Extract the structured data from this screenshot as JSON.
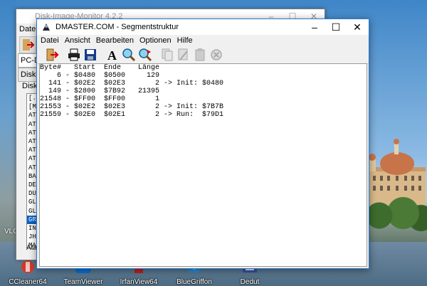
{
  "back_window": {
    "title": "Disk-Image-Monitor 4.2.2",
    "menu": [
      "Datei"
    ],
    "tab_pcdir": "PC-Dir",
    "tab_diskim": "Disk-Im",
    "disk_label": "Disk",
    "files": [
      "[..",
      "[MA",
      "ATM",
      "ATM",
      "ATM",
      "ATM",
      "ATM",
      "ATM",
      "ATM",
      "BAS",
      "DEM",
      "DUM",
      "GLU",
      "GLU",
      "GRA",
      "INS",
      "JHV",
      "MAS",
      "POK"
    ],
    "selected_index": 14,
    "status_label": "Atari"
  },
  "window": {
    "title": "DMASTER.COM - Segmentstruktur",
    "controls": {
      "minimize": "–",
      "maximize": "☐",
      "close": "✕"
    },
    "menu": [
      "Datei",
      "Ansicht",
      "Bearbeiten",
      "Optionen",
      "Hilfe"
    ],
    "toolbar_icons": [
      "exit-icon",
      "print-icon",
      "save-icon",
      "font-icon",
      "search-icon",
      "search-next-icon",
      "copy-icon",
      "cut-icon",
      "paste-icon",
      "delete-icon"
    ]
  },
  "segments": {
    "header": "Byte#   Start  Ende    Länge",
    "rows": [
      "    6 - $0480  $0500     129",
      "  141 - $02E2  $02E3       2 -> Init: $0480",
      "  149 - $2800  $7B92   21395",
      "21548 - $FF00  $FF00       1",
      "21553 - $02E2  $02E3       2 -> Init: $7B7B",
      "21559 - $02E0  $02E1       2 -> Run:  $79D1"
    ]
  },
  "desktop": {
    "icons": [
      "CCleaner64",
      "TeamViewer",
      "IrfanView64",
      "BlueGriffon",
      "Dedut"
    ],
    "side_label": "VLC"
  }
}
